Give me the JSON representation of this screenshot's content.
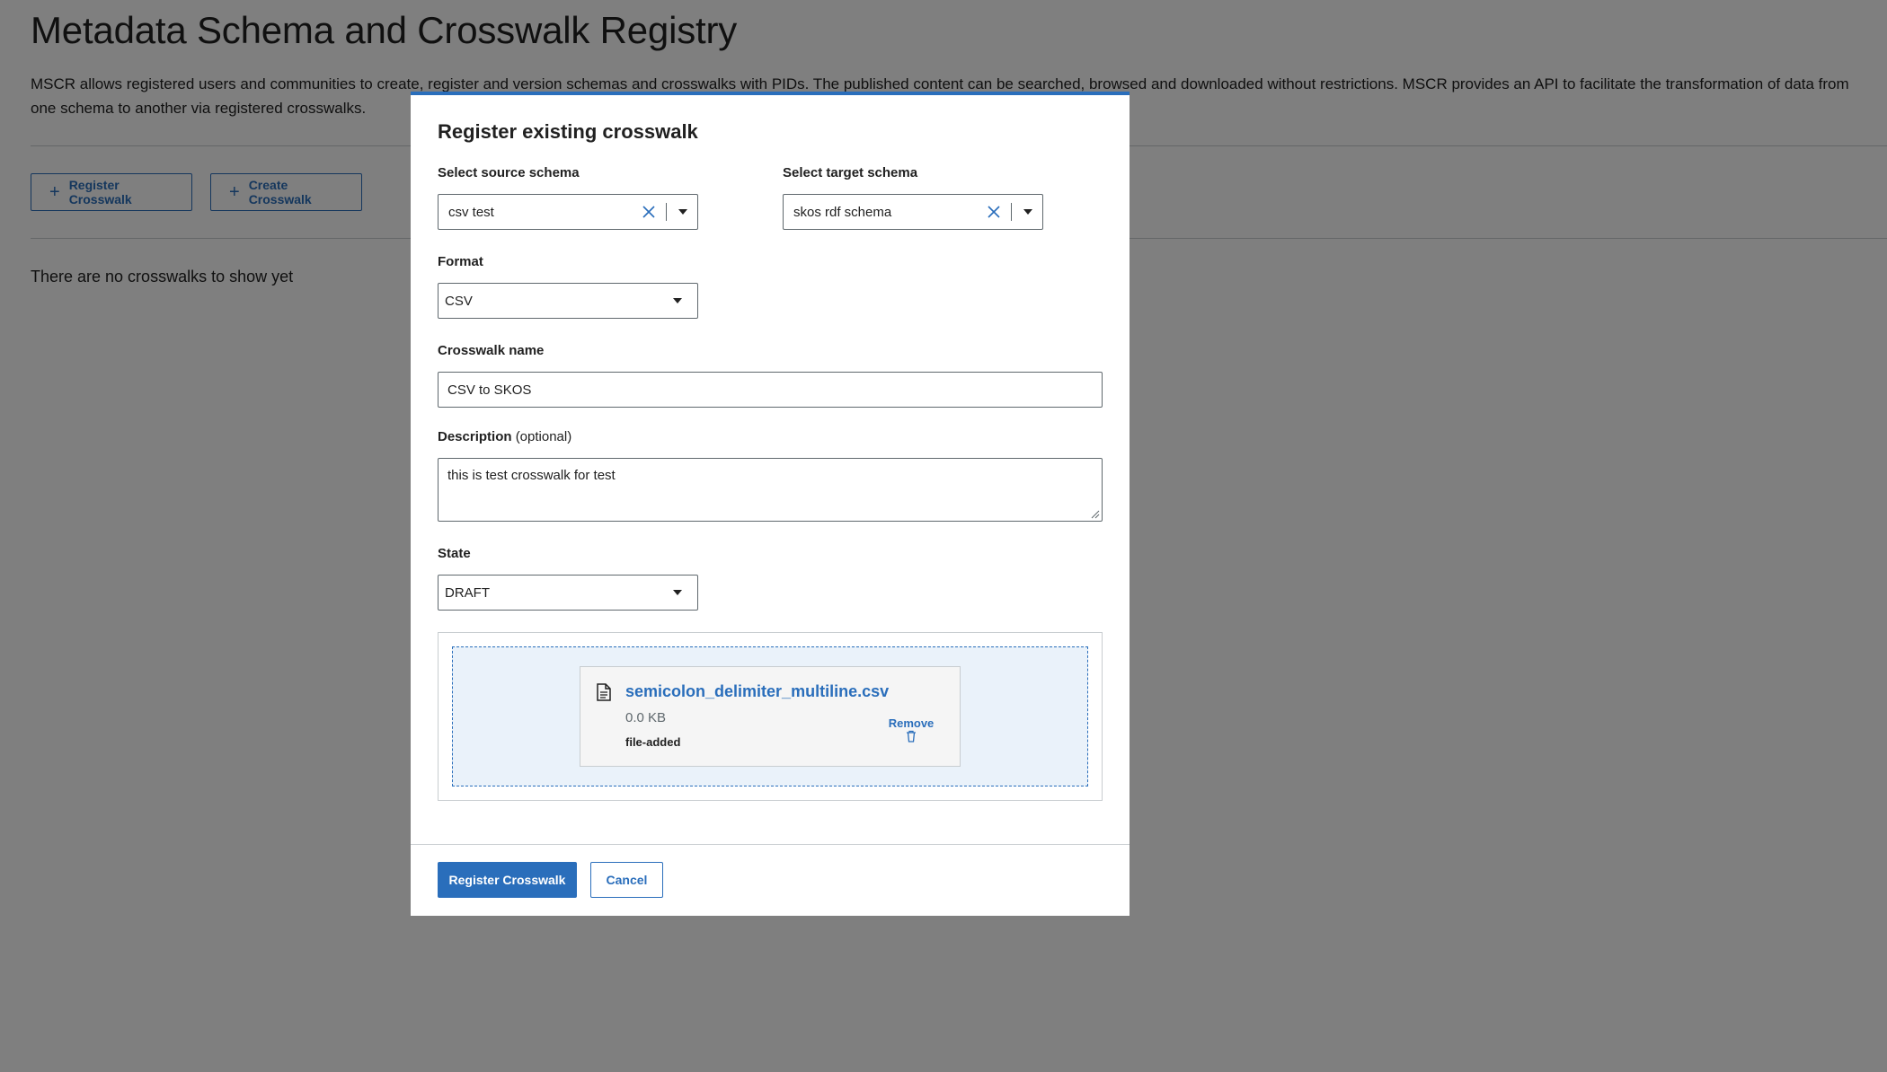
{
  "page": {
    "title": "Metadata Schema and Crosswalk Registry",
    "description": "MSCR allows registered users and communities to create, register and version schemas and crosswalks with PIDs. The published content can be searched, browsed and downloaded without restrictions. MSCR provides an API to facilitate the transformation of data from one schema to another via registered crosswalks.",
    "register_button": "Register Crosswalk",
    "create_button": "Create Crosswalk",
    "empty_message": "There are no crosswalks to show yet"
  },
  "modal": {
    "title": "Register existing crosswalk",
    "source_schema": {
      "label": "Select source schema",
      "value": "csv test"
    },
    "target_schema": {
      "label": "Select target schema",
      "value": "skos rdf schema"
    },
    "format": {
      "label": "Format",
      "value": "CSV"
    },
    "crosswalk_name": {
      "label": "Crosswalk name",
      "value": "CSV to SKOS"
    },
    "description": {
      "label": "Description",
      "optional": "(optional)",
      "value": "this is test crosswalk for test"
    },
    "state": {
      "label": "State",
      "value": "DRAFT"
    },
    "file": {
      "name": "semicolon_delimiter_multiline.csv",
      "size": "0.0 KB",
      "status": "file-added",
      "remove_label": "Remove"
    },
    "submit_button": "Register Crosswalk",
    "cancel_button": "Cancel"
  },
  "colors": {
    "accent": "#2a6ebb",
    "overlay": "rgba(0,0,0,0.5)",
    "dropzone": "#eaf2fa"
  }
}
